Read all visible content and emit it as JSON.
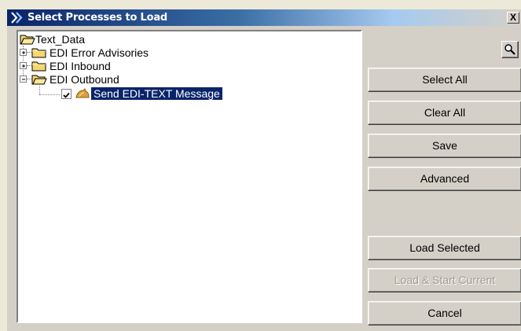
{
  "window": {
    "title": "Select Processes to Load",
    "close_label": "X"
  },
  "tree": {
    "root": {
      "label": "Text_Data",
      "icon": "open-folder-icon"
    },
    "items": [
      {
        "label": "EDI Error Advisories",
        "expander": "+",
        "icon": "folder-icon"
      },
      {
        "label": "EDI Inbound",
        "expander": "+",
        "icon": "folder-icon"
      },
      {
        "label": "EDI Outbound",
        "expander": "−",
        "icon": "open-folder-icon"
      }
    ],
    "selected_item": {
      "label": "Send EDI-TEXT Message",
      "checked": true,
      "icon": "process-icon"
    }
  },
  "buttons": {
    "find_icon": "magnifier-icon",
    "select_all": "Select All",
    "clear_all": "Clear All",
    "save": "Save",
    "advanced": "Advanced",
    "load_selected": "Load Selected",
    "load_start_current": "Load & Start Current",
    "cancel": "Cancel"
  },
  "colors": {
    "title_start": "#0a246a",
    "selection": "#0a246a",
    "face": "#d4d0c8"
  }
}
